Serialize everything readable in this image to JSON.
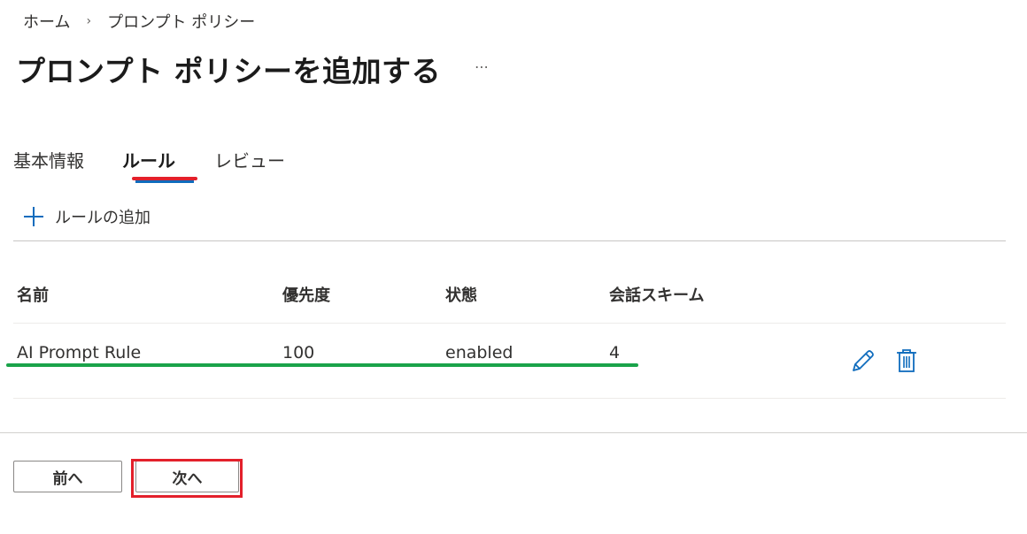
{
  "breadcrumb": {
    "items": [
      "ホーム",
      "プロンプト ポリシー"
    ],
    "separator": "›"
  },
  "page": {
    "title": "プロンプト ポリシーを追加する",
    "more_label": "⋯"
  },
  "tabs": [
    {
      "label": "基本情報",
      "active": false
    },
    {
      "label": "ルール",
      "active": true
    },
    {
      "label": "レビュー",
      "active": false
    }
  ],
  "toolbar": {
    "add_rule_label": "ルールの追加",
    "add_icon": "plus-icon"
  },
  "table": {
    "columns": [
      "名前",
      "優先度",
      "状態",
      "会話スキーム"
    ],
    "rows": [
      {
        "name": "AI Prompt Rule",
        "priority": "100",
        "state": "enabled",
        "scheme": "4"
      }
    ],
    "row_actions": [
      "edit-icon",
      "delete-icon"
    ]
  },
  "footer": {
    "prev_label": "前へ",
    "next_label": "次へ"
  },
  "colors": {
    "accent": "#0f6cbd",
    "highlight_red": "#e3202b",
    "highlight_green": "#1aa34a"
  }
}
